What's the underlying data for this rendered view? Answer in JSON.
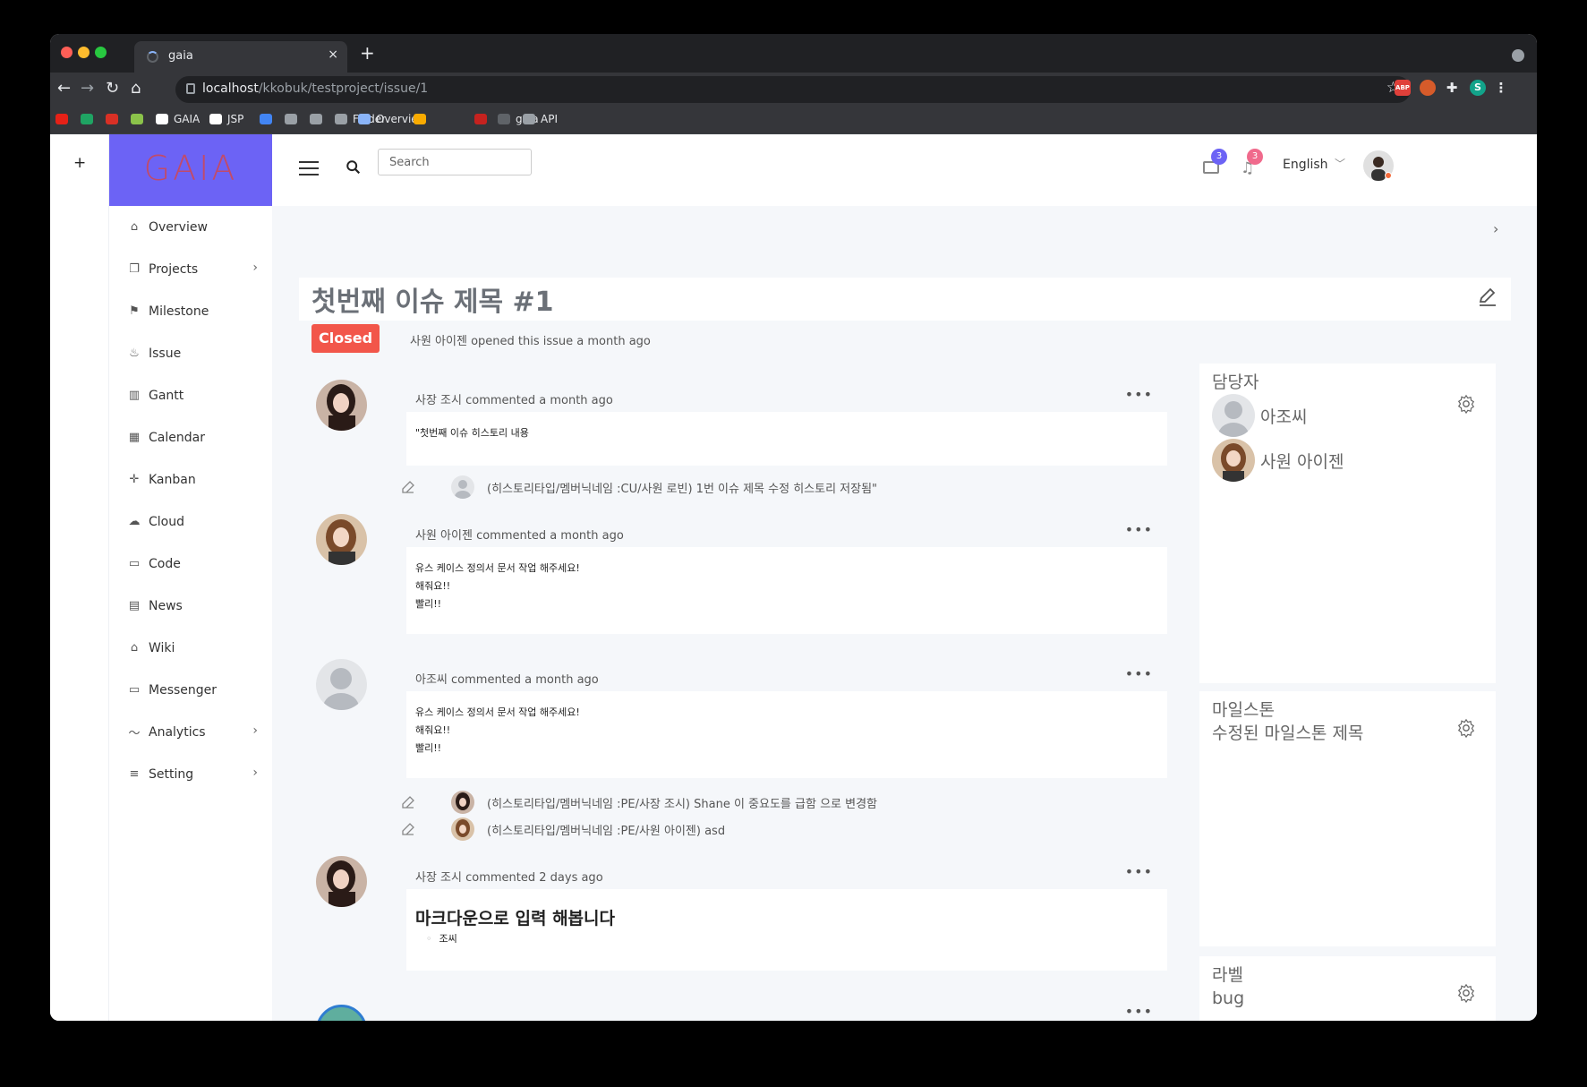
{
  "browser": {
    "tab_title": "gaia",
    "tab_close": "×",
    "new_tab": "+",
    "url_host": "localhost",
    "url_path": "/kkobuk/testproject/issue/1",
    "ext_abp": "ABP",
    "profile_initial": "S",
    "bookmarks": [
      {
        "label": "",
        "color": "#e62117"
      },
      {
        "label": "",
        "color": "#1fa463"
      },
      {
        "label": "",
        "color": "#d93025"
      },
      {
        "label": "",
        "color": "#8bc34a"
      },
      {
        "label": "GAIA",
        "color": "#ffffff"
      },
      {
        "label": "JSP",
        "color": "#ffffff"
      },
      {
        "label": "",
        "color": "#4285f4"
      },
      {
        "label": "",
        "color": "#9aa0a6"
      },
      {
        "label": "",
        "color": "#9aa0a6"
      },
      {
        "label": "Folder",
        "color": "#9aa0a6"
      },
      {
        "label": "Overview",
        "color": "#8ab4f8"
      },
      {
        "label": "",
        "color": "#f9ab00"
      },
      {
        "label": "",
        "color": "#c5221f"
      },
      {
        "label": "gaia",
        "color": "#5f6368"
      },
      {
        "label": "API",
        "color": "#9aa0a6"
      }
    ]
  },
  "app": {
    "rail_plus": "+",
    "logo": "GAIA",
    "brand_color": "#6c63f5",
    "menu": [
      {
        "label": "Overview",
        "icon": "home-icon",
        "glyph": "⌂",
        "chevron": false
      },
      {
        "label": "Projects",
        "icon": "projects-icon",
        "glyph": "❐",
        "chevron": true
      },
      {
        "label": "Milestone",
        "icon": "milestone-icon",
        "glyph": "⚑",
        "chevron": false
      },
      {
        "label": "Issue",
        "icon": "fire-icon",
        "glyph": "♨",
        "chevron": false
      },
      {
        "label": "Gantt",
        "icon": "gantt-icon",
        "glyph": "▥",
        "chevron": false
      },
      {
        "label": "Calendar",
        "icon": "calendar-icon",
        "glyph": "▦",
        "chevron": false
      },
      {
        "label": "Kanban",
        "icon": "kanban-icon",
        "glyph": "✛",
        "chevron": false
      },
      {
        "label": "Cloud",
        "icon": "cloud-icon",
        "glyph": "☁",
        "chevron": false
      },
      {
        "label": "Code",
        "icon": "monitor-icon",
        "glyph": "▭",
        "chevron": false
      },
      {
        "label": "News",
        "icon": "news-icon",
        "glyph": "▤",
        "chevron": false
      },
      {
        "label": "Wiki",
        "icon": "graduation-cap-icon",
        "glyph": "⌂",
        "chevron": false
      },
      {
        "label": "Messenger",
        "icon": "message-icon",
        "glyph": "▭",
        "chevron": false
      },
      {
        "label": "Analytics",
        "icon": "chart-line-icon",
        "glyph": "〜",
        "chevron": true
      },
      {
        "label": "Setting",
        "icon": "menu-lines-icon",
        "glyph": "≡",
        "chevron": true
      }
    ],
    "search_placeholder": "Search",
    "mail_count": "3",
    "bell_count": "3",
    "language": "English",
    "content_chevron": "›"
  },
  "issue": {
    "title": "첫번째 이슈 제목 #1",
    "status": "Closed",
    "status_color": "#f2564a",
    "opened_text": "사원 아이젠 opened this issue a month ago"
  },
  "comments": [
    {
      "header": "사장 조시 commented a month ago",
      "lines": [
        "\"첫번째 이슈 히스토리 내용"
      ]
    },
    {
      "header": "사원 아이젠 commented a month ago",
      "lines": [
        "유스 케이스 정의서 문서 작업 해주세요!",
        "해줘요!!",
        "빨리!!"
      ]
    },
    {
      "header": "아조씨 commented a month ago",
      "lines": [
        "유스 케이스 정의서 문서 작업 해주세요!",
        "해줘요!!",
        "빨리!!"
      ]
    },
    {
      "header": "사장 조시 commented 2 days ago",
      "heading": "마크다운으로 입력 해봅니다",
      "bullet": "조씨"
    }
  ],
  "history": [
    "(히스토리타입/멤버닉네임 :CU/사원 로빈) 1번 이슈 제목 수정 히스토리 저장됨\"",
    "(히스토리타입/멤버닉네임 :PE/사장 조시) Shane 이 중요도를 급함 으로 변경함",
    "(히스토리타입/멤버닉네임 :PE/사원 아이젠) asd"
  ],
  "more_dots": "•••",
  "sidebar_right": {
    "assignee_title": "담당자",
    "assignees": [
      "아조씨",
      "사원 아이젠"
    ],
    "milestone_title": "마일스톤",
    "milestone_value": "수정된 마일스톤 제목",
    "label_title": "라벨",
    "label_value": "bug"
  }
}
